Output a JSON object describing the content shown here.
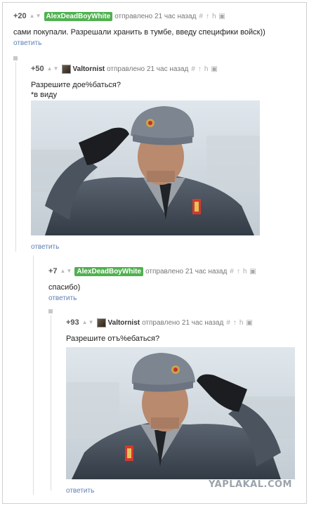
{
  "comments": [
    {
      "score": "+20",
      "user": "AlexDeadBoyWhite",
      "meta": "отправлено 21 час назад",
      "text": "сами покупали. Разрешали хранить в тумбе, введу специфики войск))",
      "reply": "ответить"
    },
    {
      "score": "+50",
      "user": "Valtornist",
      "meta": "отправлено 21 час назад",
      "text_line1": "Разрешите дое%баться?",
      "text_line2": "*в виду",
      "reply": "ответить"
    },
    {
      "score": "+7",
      "user": "AlexDeadBoyWhite",
      "meta": "отправлено 21 час назад",
      "text": "спасибо)",
      "reply": "ответить"
    },
    {
      "score": "+93",
      "user": "Valtornist",
      "meta": "отправлено 21 час назад",
      "text": "Разрешите отъ%ебаться?",
      "reply": "ответить"
    }
  ],
  "actions": {
    "hash": "#",
    "up": "↑",
    "tree": "h",
    "save": "💾"
  },
  "watermark": "YAPLAKAL.COM"
}
